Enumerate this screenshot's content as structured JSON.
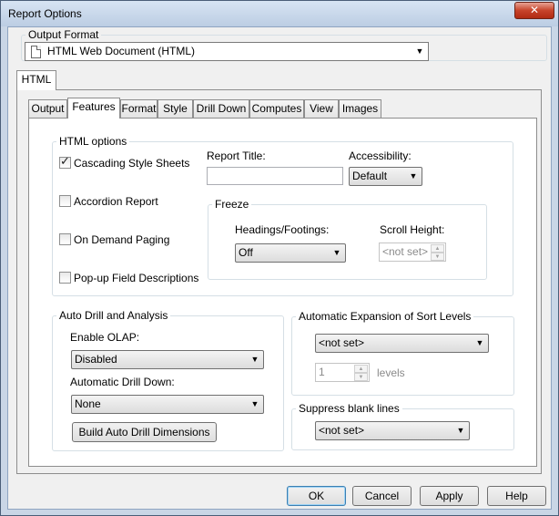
{
  "window": {
    "title": "Report Options"
  },
  "output_format": {
    "label": "Output Format",
    "value": "HTML Web Document (HTML)"
  },
  "outer_tab": {
    "label": "HTML"
  },
  "tabs": [
    "Output",
    "Features",
    "Format",
    "Style",
    "Drill Down",
    "Computes",
    "View",
    "Images"
  ],
  "active_tab": "Features",
  "html_options": {
    "legend": "HTML options",
    "cascading_style_sheets": {
      "label": "Cascading Style Sheets",
      "checked": true
    },
    "accordion_report": {
      "label": "Accordion Report",
      "checked": false
    },
    "on_demand_paging": {
      "label": "On Demand Paging",
      "checked": false
    },
    "popup_field_descriptions": {
      "label": "Pop-up Field Descriptions",
      "checked": false
    },
    "report_title": {
      "label": "Report Title:",
      "value": ""
    },
    "accessibility": {
      "label": "Accessibility:",
      "value": "Default"
    },
    "freeze": {
      "legend": "Freeze",
      "headings_label": "Headings/Footings:",
      "headings_value": "Off",
      "scroll_height_label": "Scroll Height:",
      "scroll_height_value": "<not set>"
    }
  },
  "auto_drill": {
    "legend": "Auto Drill and Analysis",
    "enable_olap_label": "Enable OLAP:",
    "enable_olap_value": "Disabled",
    "auto_drill_down_label": "Automatic Drill Down:",
    "auto_drill_down_value": "None",
    "build_button": "Build Auto Drill Dimensions"
  },
  "sort_expansion": {
    "legend": "Automatic Expansion of Sort Levels",
    "value": "<not set>",
    "levels_value": "1",
    "levels_label": "levels"
  },
  "suppress_blank": {
    "legend": "Suppress blank lines",
    "value": "<not set>"
  },
  "buttons": {
    "ok": "OK",
    "cancel": "Cancel",
    "apply": "Apply",
    "help": "Help"
  },
  "icons": {
    "close": "close-icon",
    "dropdown": "chevron-down-icon",
    "document": "document-icon"
  }
}
